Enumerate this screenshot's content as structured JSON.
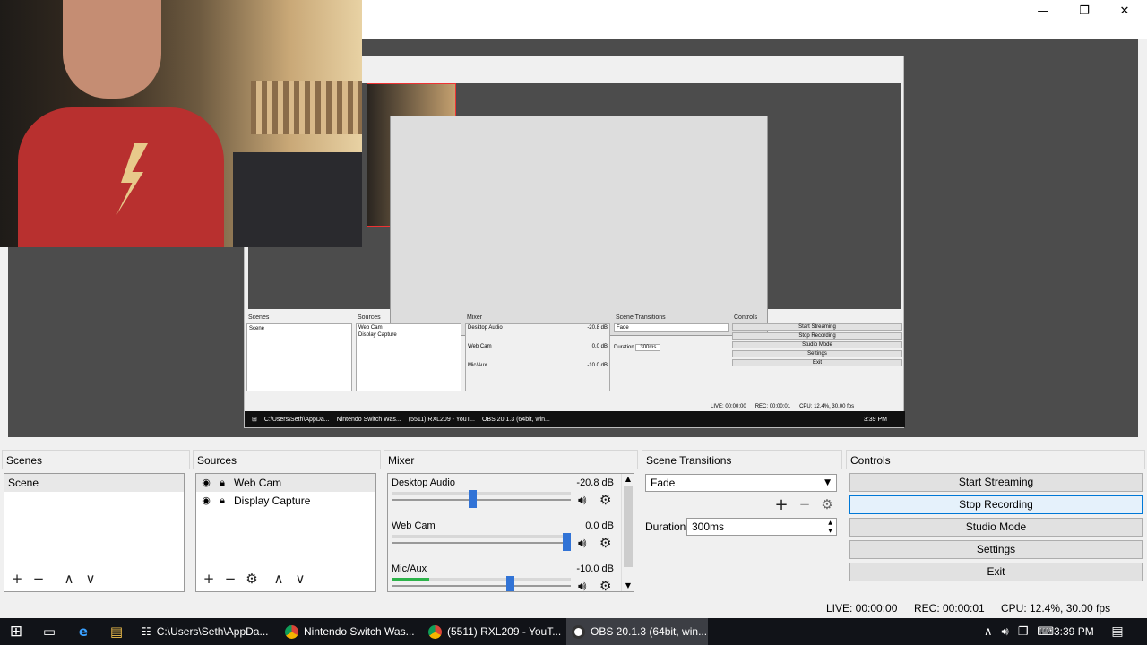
{
  "window": {
    "minimize_icon": "minimize-icon",
    "maximize_icon": "restore-icon",
    "close_icon": "close-icon"
  },
  "nested_preview": {
    "scenes_title": "Scenes",
    "scene": "Scene",
    "sources_title": "Sources",
    "sources": [
      "Web Cam",
      "Display Capture"
    ],
    "mixer_title": "Mixer",
    "mixer": [
      {
        "name": "Desktop Audio",
        "db": "-20.8 dB"
      },
      {
        "name": "Web Cam",
        "db": "0.0 dB"
      },
      {
        "name": "Mic/Aux",
        "db": "-10.0 dB"
      }
    ],
    "transitions_title": "Scene Transitions",
    "transition": "Fade",
    "duration_label": "Duration",
    "duration": "300ms",
    "controls_title": "Controls",
    "controls": [
      "Start Streaming",
      "Stop Recording",
      "Studio Mode",
      "Settings",
      "Exit"
    ],
    "status": {
      "live": "LIVE: 00:00:00",
      "rec": "REC: 00:00:01",
      "cpu": "CPU: 12.4%, 30.00 fps"
    },
    "taskbar": [
      "C:\\Users\\Seth\\AppDa...",
      "Nintendo Switch Was...",
      "(5511) RXL209 - YouT...",
      "OBS 20.1.3 (64bit, win..."
    ],
    "clock": "3:39 PM"
  },
  "docks": {
    "scenes": {
      "title": "Scenes",
      "items": [
        "Scene"
      ]
    },
    "sources": {
      "title": "Sources",
      "items": [
        "Web Cam",
        "Display Capture"
      ]
    },
    "mixer": {
      "title": "Mixer",
      "channels": [
        {
          "name": "Desktop Audio",
          "db": "-20.8 dB",
          "level": 0.45,
          "meter": 0.0
        },
        {
          "name": "Web Cam",
          "db": "0.0 dB",
          "level": 1.0,
          "meter": 0.0
        },
        {
          "name": "Mic/Aux",
          "db": "-10.0 dB",
          "level": 0.67,
          "meter": 0.21
        }
      ]
    },
    "transitions": {
      "title": "Scene Transitions",
      "selected": "Fade",
      "duration_label": "Duration",
      "duration": "300ms"
    },
    "controls": {
      "title": "Controls",
      "buttons": [
        "Start Streaming",
        "Stop Recording",
        "Studio Mode",
        "Settings",
        "Exit"
      ]
    }
  },
  "status": {
    "live": "LIVE: 00:00:00",
    "rec": "REC: 00:00:01",
    "cpu": "CPU: 12.4%, 30.00 fps"
  },
  "taskbar": {
    "apps": [
      {
        "label": "C:\\Users\\Seth\\AppDa...",
        "icon": "file-explorer-icon"
      },
      {
        "label": "Nintendo Switch Was...",
        "icon": "chrome-icon"
      },
      {
        "label": "(5511) RXL209 - YouT...",
        "icon": "chrome-icon"
      },
      {
        "label": "OBS 20.1.3 (64bit, win...",
        "icon": "obs-icon"
      }
    ],
    "clock": "3:39 PM"
  },
  "colors": {
    "accent": "#3173d6",
    "meter_green": "#2db34a",
    "taskbar": "#111318",
    "preview_bg": "#4c4c4c"
  }
}
